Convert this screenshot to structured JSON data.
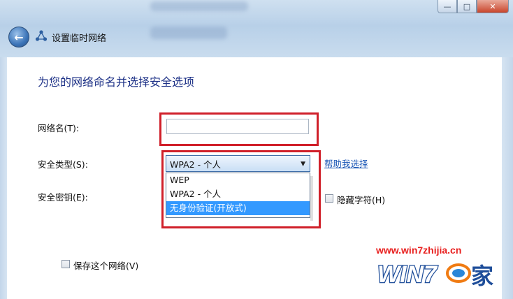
{
  "window": {
    "title": "设置临时网络",
    "minimize_glyph": "—",
    "maximize_glyph": "□",
    "close_glyph": "✕"
  },
  "page": {
    "heading": "为您的网络命名并选择安全选项"
  },
  "form": {
    "network_name_label": "网络名(T):",
    "network_name_value": "",
    "security_type_label": "安全类型(S):",
    "security_type_selected": "WPA2 - 个人",
    "security_type_options": [
      "WEP",
      "WPA2 - 个人",
      "无身份验证(开放式)"
    ],
    "highlighted_option_index": 2,
    "help_link": "帮助我选择",
    "security_key_label": "安全密钥(E):",
    "hide_chars_label": "隐藏字符(H)",
    "hide_chars_checked": false,
    "save_network_label": "保存这个网络(V)",
    "save_network_checked": false
  },
  "watermark": {
    "url": "www.win7zhijia.cn",
    "logo_text": "WIN7",
    "logo_suffix": "家"
  },
  "colors": {
    "highlight_box": "#d0202a",
    "selected_option": "#3399ff",
    "heading": "#1e3287",
    "link": "#1a56b5"
  }
}
